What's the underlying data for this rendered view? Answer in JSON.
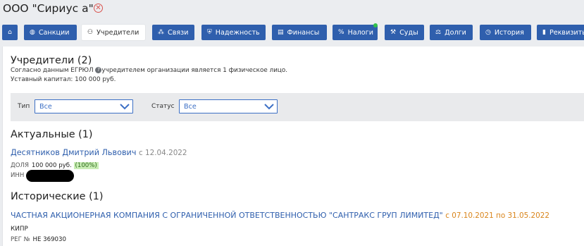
{
  "header": {
    "company_name": "ООО \"Сириус а\"",
    "close_symbol": "⊗"
  },
  "tabs": [
    {
      "id": "home",
      "label": "",
      "icon": "home-icon",
      "glyph": "⌂"
    },
    {
      "id": "sanctions",
      "label": "Санкции",
      "icon": "globe-icon",
      "glyph": "◍"
    },
    {
      "id": "founders",
      "label": "Учредители",
      "icon": "users-icon",
      "glyph": "👥",
      "active": true
    },
    {
      "id": "links",
      "label": "Связи",
      "icon": "network-icon",
      "glyph": "⁂"
    },
    {
      "id": "reliability",
      "label": "Надежность",
      "icon": "shield-icon",
      "glyph": "⛨"
    },
    {
      "id": "finance",
      "label": "Финансы",
      "icon": "chart-icon",
      "glyph": "▤"
    },
    {
      "id": "taxes",
      "label": "Налоги",
      "icon": "percent-icon",
      "glyph": "%"
    },
    {
      "id": "courts",
      "label": "Суды",
      "icon": "gavel-icon",
      "glyph": "⚒"
    },
    {
      "id": "debts",
      "label": "Долги",
      "icon": "scales-icon",
      "glyph": "⚖"
    },
    {
      "id": "history",
      "label": "История",
      "icon": "history-icon",
      "glyph": "◷"
    },
    {
      "id": "requisites",
      "label": "Реквизиты",
      "icon": "document-icon",
      "glyph": "▮"
    }
  ],
  "founders": {
    "title": "Учредители (2)",
    "note_prefix": "Согласно данным ЕГРЮЛ",
    "note_help": "?",
    "note_suffix": "учредителем организации является 1 физическое лицо.",
    "capital": "Уставный капитал: 100 000 руб."
  },
  "filters": {
    "type_label": "Тип",
    "type_value": "Все",
    "status_label": "Статус",
    "status_value": "Все"
  },
  "current": {
    "title": "Актуальные (1)",
    "person_name": "Десятников Дмитрий Львович",
    "person_since": "с 12.04.2022",
    "share_label": "ДОЛЯ",
    "share_value": "100 000 руб.",
    "share_percent": "(100%)",
    "inn_label": "ИНН"
  },
  "historical": {
    "title": "Исторические (1)",
    "company_name": "ЧАСТНАЯ АКЦИОНЕРНАЯ КОМПАНИЯ С ОГРАНИЧЕННОЙ ОТВЕТСТВЕННОСТЬЮ \"САНТРАКС ГРУП ЛИМИТЕД\"",
    "period": "с 07.10.2021 по 31.05.2022",
    "country": "КИПР",
    "reg_label": "РЕГ №",
    "reg_value": "HE 369030"
  },
  "colors": {
    "tab_blue": "#2f5fad",
    "link_blue": "#2f5fad",
    "close_red": "#d9534f",
    "period_orange": "#d9841a",
    "badge_green": "#c9edb5",
    "indicator_green": "#32c14a"
  }
}
